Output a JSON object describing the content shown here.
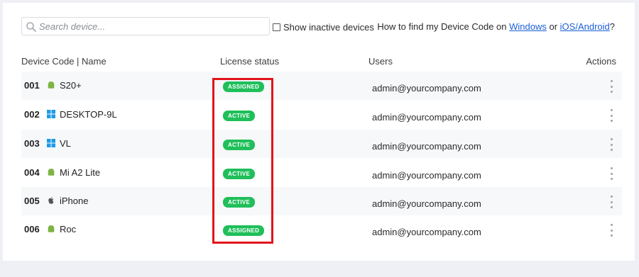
{
  "toolbar": {
    "search_placeholder": "Search device...",
    "show_inactive_label": "Show inactive devices",
    "help_prefix": "How to find my Device Code on ",
    "help_windows": "Windows",
    "help_or": " or ",
    "help_ios": "iOS/Android",
    "help_suffix": "?"
  },
  "table": {
    "headers": {
      "device": "Device Code | Name",
      "license": "License status",
      "users": "Users",
      "actions": "Actions"
    },
    "rows": [
      {
        "code": "001",
        "os": "android",
        "name": "S20+",
        "status": "ASSIGNED",
        "user": "admin@yourcompany.com"
      },
      {
        "code": "002",
        "os": "windows",
        "name": "DESKTOP-9L",
        "status": "ACTIVE",
        "user": "admin@yourcompany.com"
      },
      {
        "code": "003",
        "os": "windows",
        "name": "VL",
        "status": "ACTIVE",
        "user": "admin@yourcompany.com"
      },
      {
        "code": "004",
        "os": "android",
        "name": "Mi A2 Lite",
        "status": "ACTIVE",
        "user": "admin@yourcompany.com"
      },
      {
        "code": "005",
        "os": "apple",
        "name": "iPhone",
        "status": "ACTIVE",
        "user": "admin@yourcompany.com"
      },
      {
        "code": "006",
        "os": "android",
        "name": "Roc",
        "status": "ASSIGNED",
        "user": "admin@yourcompany.com"
      }
    ]
  },
  "colors": {
    "badge_green": "#1fbf5a",
    "highlight_red": "#e1141a",
    "link_blue": "#1a5fd6",
    "android_green": "#7cb342",
    "windows_blue": "#1e9be6",
    "apple_gray": "#555555"
  }
}
